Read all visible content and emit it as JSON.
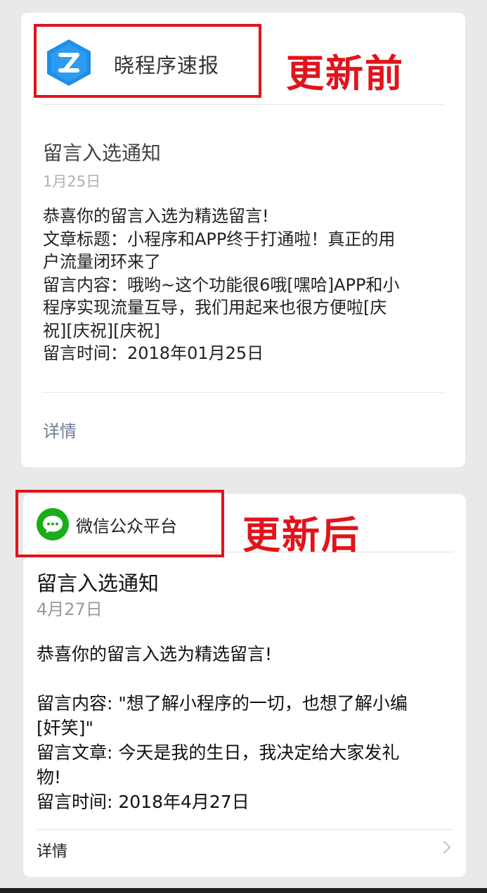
{
  "before": {
    "account_name": "晓程序速报",
    "label": "更新前",
    "title": "留言入选通知",
    "date": "1月25日",
    "body": [
      "恭喜你的留言入选为精选留言!",
      "文章标题：小程序和APP终于打通啦！真正的用",
      "户流量闭环来了",
      "留言内容：哦哟~这个功能很6哦[嘿哈]APP和小",
      "程序实现流量互导，我们用起来也很方便啦[庆",
      "祝][庆祝][庆祝]",
      "留言时间：2018年01月25日"
    ],
    "detail": "详情",
    "colors": {
      "logo": "#1f8ee6",
      "accent_red": "#e0141b"
    },
    "logo_icon": "z-logo-icon"
  },
  "after": {
    "account_name": "微信公众平台",
    "label": "更新后",
    "title": "留言入选通知",
    "date": "4月27日",
    "body": [
      "恭喜你的留言入选为精选留言!",
      "",
      "留言内容: \"想了解小程序的一切，也想了解小编",
      "[奸笑]\"",
      "留言文章: 今天是我的生日，我决定给大家发礼",
      "物!",
      "留言时间: 2018年4月27日"
    ],
    "detail": "详情",
    "colors": {
      "logo": "#1aad19"
    },
    "logo_icon": "wechat-chat-icon"
  }
}
